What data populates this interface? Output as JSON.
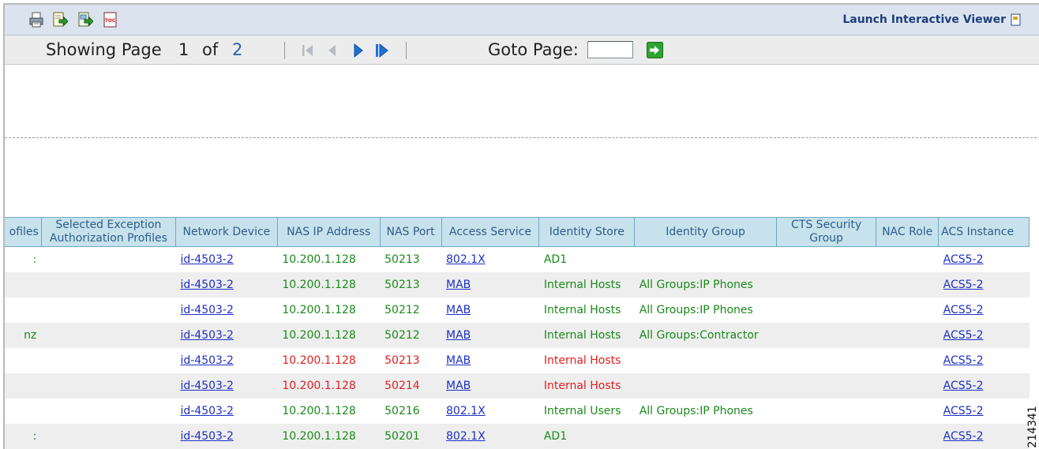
{
  "toolbar": {
    "icons": [
      "print-icon",
      "export-data-icon",
      "export-content-icon",
      "toc-icon"
    ],
    "toc_label": "TOC",
    "launch_label": "Launch Interactive Viewer"
  },
  "pager": {
    "showing_label": "Showing Page",
    "current_page": "1",
    "of_label": "of",
    "total_pages": "2",
    "goto_label": "Goto Page:",
    "goto_value": ""
  },
  "table": {
    "columns": [
      "ofiles",
      "Selected Exception Authorization Profiles",
      "Network Device",
      "NAS IP Address",
      "NAS Port",
      "Access Service",
      "Identity Store",
      "Identity Group",
      "CTS Security Group",
      "NAC Role",
      "ACS Instance"
    ],
    "rows": [
      {
        "c0": ":",
        "device": "id-4503-2",
        "ip": "10.200.1.128",
        "port": "50213",
        "service": "802.1X",
        "store": "AD1",
        "group": "",
        "instance": "ACS5-2",
        "status": "pass"
      },
      {
        "c0": "",
        "device": "id-4503-2",
        "ip": "10.200.1.128",
        "port": "50213",
        "service": "MAB",
        "store": "Internal Hosts",
        "group": "All Groups:IP Phones",
        "instance": "ACS5-2",
        "status": "pass"
      },
      {
        "c0": "",
        "device": "id-4503-2",
        "ip": "10.200.1.128",
        "port": "50212",
        "service": "MAB",
        "store": "Internal Hosts",
        "group": "All Groups:IP Phones",
        "instance": "ACS5-2",
        "status": "pass"
      },
      {
        "c0": "nz",
        "device": "id-4503-2",
        "ip": "10.200.1.128",
        "port": "50212",
        "service": "MAB",
        "store": "Internal Hosts",
        "group": "All Groups:Contractor",
        "instance": "ACS5-2",
        "status": "pass"
      },
      {
        "c0": "",
        "device": "id-4503-2",
        "ip": "10.200.1.128",
        "port": "50213",
        "service": "MAB",
        "store": "Internal Hosts",
        "group": "",
        "instance": "ACS5-2",
        "status": "fail"
      },
      {
        "c0": "",
        "device": "id-4503-2",
        "ip": "10.200.1.128",
        "port": "50214",
        "service": "MAB",
        "store": "Internal Hosts",
        "group": "",
        "instance": "ACS5-2",
        "status": "fail"
      },
      {
        "c0": "",
        "device": "id-4503-2",
        "ip": "10.200.1.128",
        "port": "50216",
        "service": "802.1X",
        "store": "Internal Users",
        "group": "All Groups:IP Phones",
        "instance": "ACS5-2",
        "status": "pass"
      },
      {
        "c0": ":",
        "device": "id-4503-2",
        "ip": "10.200.1.128",
        "port": "50201",
        "service": "802.1X",
        "store": "AD1",
        "group": "",
        "instance": "ACS5-2",
        "status": "pass"
      }
    ]
  },
  "colors": {
    "pass": "#1a8a1a",
    "fail": "#e02020",
    "link": "#1c30c4",
    "header_bg": "#c7e2ec"
  },
  "figure_id": "214341"
}
